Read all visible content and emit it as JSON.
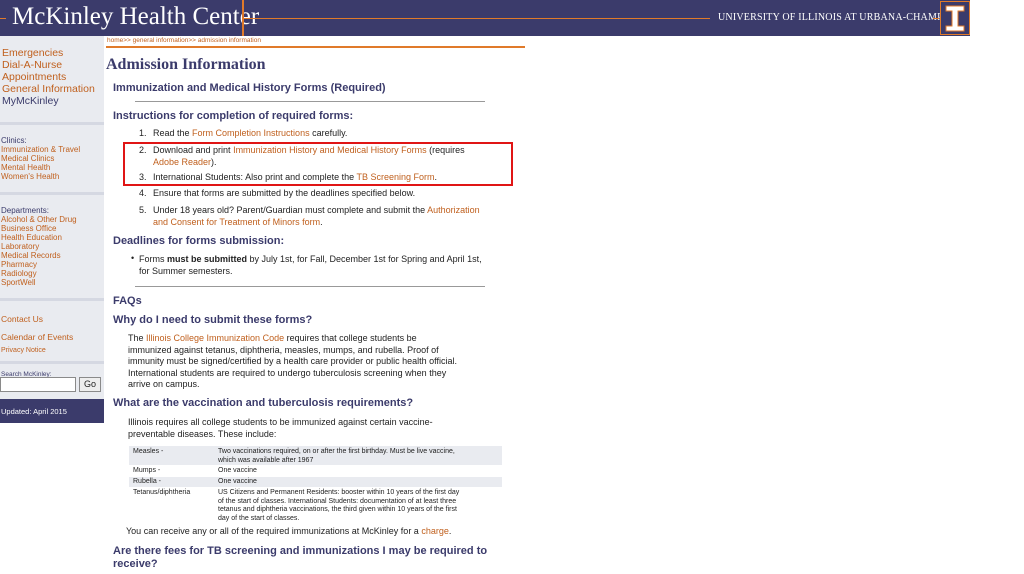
{
  "header": {
    "site_title": "McKinley Health Center",
    "university": "UNIVERSITY OF ILLINOIS AT URBANA-CHAMPAIGN",
    "colors": {
      "brand": "#3b3b6b",
      "accent": "#e07a2a"
    }
  },
  "sidebar": {
    "main_links": [
      "Emergencies",
      "Dial-A-Nurse",
      "Appointments",
      "General Information",
      "MyMcKinley"
    ],
    "clinics_heading": "Clinics:",
    "clinics": [
      "Immunization & Travel",
      "Medical Clinics",
      "Mental Health",
      "Women's Health"
    ],
    "departments_heading": "Departments:",
    "departments": [
      "Alcohol & Other Drug",
      "Business Office",
      "Health Education",
      "Laboratory",
      "Medical Records",
      "Pharmacy",
      "Radiology",
      "SportWell"
    ],
    "contact": "Contact Us",
    "calendar": "Calendar of Events",
    "privacy": "Privacy Notice",
    "search_label": "Search McKinley:",
    "search_value": "",
    "go_label": "Go",
    "updated": "Updated: April 2015"
  },
  "breadcrumb": {
    "home": "home",
    "general": "general information",
    "current": "admission information",
    "sep": ">> "
  },
  "page": {
    "title": "Admission Information",
    "subtitle": "Immunization and Medical History Forms (Required)",
    "instructions_heading": "Instructions for completion of required forms:",
    "steps": [
      {
        "num": "1.",
        "pre": "Read the ",
        "link": "Form Completion Instructions",
        "post": " carefully."
      },
      {
        "num": "2.",
        "pre": "Download and print ",
        "link": "Immunization History and Medical History Forms",
        "post": " (requires",
        "line2_link": "Adobe Reader",
        "line2_post": ")."
      },
      {
        "num": "3.",
        "pre": "International Students: Also print and complete the ",
        "link": "TB Screening Form",
        "post": "."
      },
      {
        "num": "4.",
        "pre": "Ensure that forms are submitted by the deadlines specified below."
      },
      {
        "num": "5.",
        "pre": "Under 18 years old? Parent/Guardian must complete and submit the ",
        "link": "Authorization",
        "line2_link": "and Consent for Treatment of Minors form",
        "line2_post": "."
      }
    ],
    "deadlines_heading": "Deadlines for forms submission:",
    "deadline_pre": "Forms ",
    "deadline_bold": "must be submitted",
    "deadline_post": " by July 1st, for Fall, December 1st for Spring and April 1st,",
    "deadline_line2": "for Summer semesters.",
    "bullet": "•",
    "faqs_heading": "FAQs",
    "q1": "Why do I need to submit these forms?",
    "a1_pre": "The ",
    "a1_link": "Illinois College Immunization Code",
    "a1_post": " requires that college students be",
    "a1_lines": [
      "immunized against tetanus, diphtheria, measles, mumps, and rubella. Proof of",
      "immunity must be signed/certified by a health care provider or public health official.",
      "International students are required to undergo tuberculosis screening when they",
      "arrive on campus."
    ],
    "q2": "What are the vaccination and tuberculosis requirements?",
    "a2_lines": [
      "Illinois requires all college students to be immunized against certain vaccine-",
      "preventable diseases. These include:"
    ],
    "vaccines": [
      {
        "name": "Measles -",
        "lines": [
          "Two vaccinations required, on or after the first birthday. Must be live vaccine,",
          "which was available after 1967"
        ]
      },
      {
        "name": "Mumps -",
        "lines": [
          "One vaccine"
        ]
      },
      {
        "name": "Rubella -",
        "lines": [
          "One vaccine"
        ]
      },
      {
        "name": "Tetanus/diphtheria",
        "lines": [
          "US Citizens and Permanent Residents: booster within 10 years of the first day",
          "of the start of classes. International Students: documentation of at least three",
          "tetanus and diphtheria vaccinations, the third given within 10 years of the first",
          "day of the start of classes."
        ]
      }
    ],
    "charge_pre": "You can receive any or all of the required immunizations at McKinley for a ",
    "charge_link": "charge",
    "charge_post": ".",
    "q3_lines": [
      "Are there fees for TB screening and immunizations I may be required to",
      "receive?"
    ]
  }
}
